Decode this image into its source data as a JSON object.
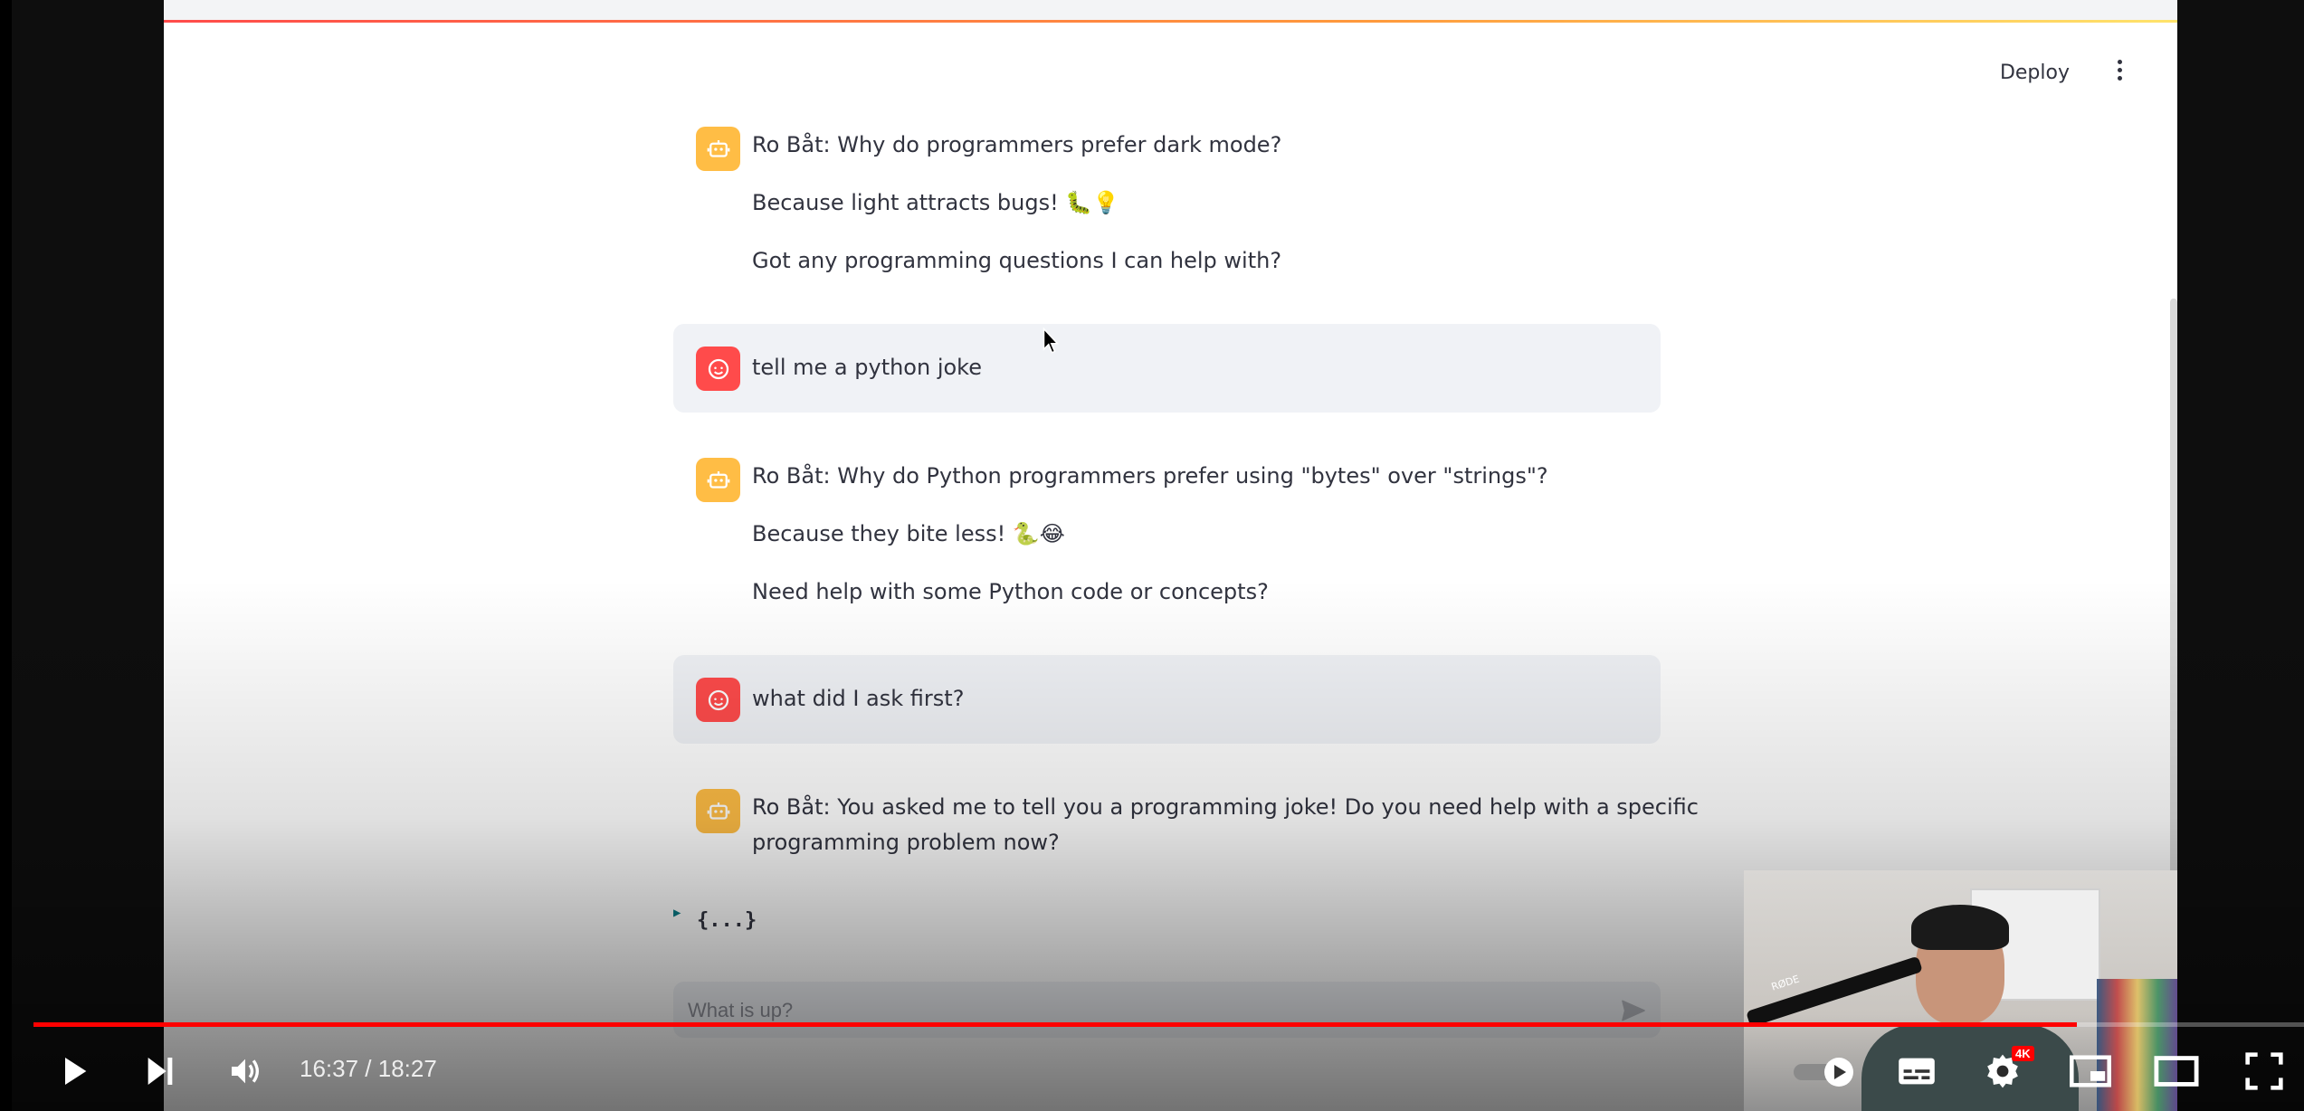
{
  "app": {
    "deploy_label": "Deploy",
    "input_placeholder": "What is up?",
    "expander_text": "{...}"
  },
  "messages": [
    {
      "role": "assistant",
      "lines": [
        "Ro Båt: Why do programmers prefer dark mode?",
        "Because light attracts bugs! 🐛💡",
        "Got any programming questions I can help with?"
      ]
    },
    {
      "role": "user",
      "lines": [
        "tell me a python joke"
      ]
    },
    {
      "role": "assistant",
      "lines": [
        "Ro Båt: Why do Python programmers prefer using \"bytes\" over \"strings\"?",
        "Because they bite less! 🐍😂",
        "Need help with some Python code or concepts?"
      ]
    },
    {
      "role": "user",
      "lines": [
        "what did I ask first?"
      ]
    },
    {
      "role": "assistant",
      "lines": [
        "Ro Båt: You asked me to tell you a programming joke! Do you need help with a specific",
        "programming problem now?"
      ]
    }
  ],
  "player": {
    "current_time": "16:37",
    "duration": "18:27",
    "time_display": "16:37 / 18:27",
    "progress": 0.8998,
    "quality_badge": "4K",
    "pip_mic_label": "RØDE"
  },
  "colors": {
    "bot_avatar": "#ffbd45",
    "user_avatar": "#ff4b4b",
    "progress": "#ff0000",
    "text": "#31333f"
  }
}
